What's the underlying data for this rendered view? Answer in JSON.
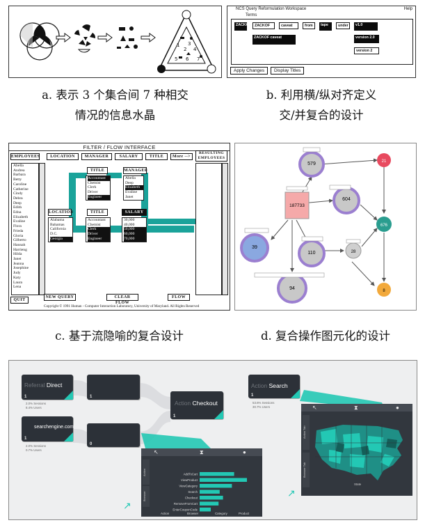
{
  "panels": {
    "a": {
      "caption_line1": "a. 表示 3 个集合间 7 种相交",
      "caption_line2": "情况的信息水晶",
      "triangle_numbers": [
        "1",
        "2",
        "3",
        "4",
        "5",
        "6",
        "7"
      ]
    },
    "b": {
      "caption_line1": "b. 利用横/纵对齐定义",
      "caption_line2": "交/并复合的设计",
      "window_title": "NCS Query Reformulation Workspace",
      "menu": "Terms",
      "help": "Help",
      "boxes": [
        "ZACKOF",
        "caveat",
        "from",
        "tape",
        "under"
      ],
      "row2_box": "ZACKOF caveat",
      "right_boxes": [
        "v1.0",
        "version 2.0",
        "version 2"
      ],
      "buttons": [
        "Apply Changes",
        "Display Titles"
      ]
    },
    "c": {
      "caption": "c. 基于流隐喻的复合设计",
      "title": "FILTER / FLOW INTERFACE",
      "employees_header": "EMPLOYEES",
      "employees": [
        "Abella",
        "Andrea",
        "Barbara",
        "Betty",
        "Caroline",
        "Catherine",
        "Cindy",
        "Debra",
        "Deep",
        "Edith",
        "Edna",
        "Elizabeth",
        "Evaline",
        "Flora",
        "Frieda",
        "Gloria",
        "Gilberto",
        "Hannah",
        "Harrieng",
        "Hilda",
        "Janet",
        "Jeanna",
        "Josephine",
        "Judy",
        "Katy",
        "Laura",
        "Lena"
      ],
      "top_tabs": [
        "LOCATION",
        "MANAGER",
        "SALARY",
        "TITLE"
      ],
      "more": "More -->",
      "resulting_header": "RESULTING EMPLOYEES",
      "title_label": "TITLE",
      "title_items": [
        "Accountant",
        "Chemist",
        "Clerk",
        "Driver",
        "Engineer"
      ],
      "manager_label": "MANAGER",
      "manager_items": [
        "Abella",
        "Deep",
        "Elizabeth",
        "Evaline",
        "Janet"
      ],
      "location_label": "LOCATION",
      "location_items": [
        "Alabama",
        "Bahamas",
        "California",
        "D.C.",
        "Georgia"
      ],
      "title2_label": "TITLE",
      "title2_items": [
        "Accountant",
        "Chemist",
        "Clerk",
        "Driver",
        "Engineer"
      ],
      "salary_label": "SALARY",
      "salary_items": [
        "30,000",
        "40,000",
        "50,000",
        "60,000",
        "70,000"
      ],
      "buttons": [
        "NEW QUERY",
        "CLEAR FLOW",
        "FLOW"
      ],
      "quit": "QUIT",
      "footer": "Copyright © 1991 Human - Computer Interaction Laboratory, University of Maryland. All Rights Reserved"
    },
    "d": {
      "caption": "d. 复合操作图元化的设计",
      "nodes": [
        "579",
        "187733",
        "604",
        "21",
        "39",
        "110",
        "28",
        "676",
        "94",
        "8"
      ]
    },
    "e": {
      "nodes": {
        "referral": {
          "faint": "Referral",
          "bold": "Direct",
          "num": "1",
          "stats": [
            "2.0% Sessions",
            "8.4% Users"
          ]
        },
        "search": {
          "faint": "",
          "bold": "searchengine.com",
          "num": "1",
          "stats": [
            "2.0% Sessions",
            "0.7% Users"
          ]
        },
        "blank1": {
          "num": "1"
        },
        "blank2": {
          "num": "0"
        },
        "checkout": {
          "faint": "Action",
          "bold": "Checkout",
          "num": "1"
        },
        "action_search": {
          "faint": "Action",
          "bold": "Search",
          "num": "1",
          "stats": [
            "53.6% Sessions",
            "30.7% Users"
          ]
        }
      },
      "bar_labels": [
        "AddToCart",
        "ViewProduct",
        "ViewCategory",
        "Search",
        "Checkout",
        "RemoveFromCart",
        "EnterCouponCode"
      ],
      "bar_values": [
        0.62,
        0.85,
        0.58,
        0.36,
        0.42,
        0.34,
        0.2
      ],
      "popup_tabs": [
        "Action",
        "Browser",
        "Category",
        "Product"
      ],
      "side_tabs": [
        "Action",
        "Browser"
      ],
      "map_side_tabs": [
        "Action Tab",
        "Browser Tab"
      ],
      "map_footer": "State",
      "accent": "#23c8b4"
    }
  }
}
